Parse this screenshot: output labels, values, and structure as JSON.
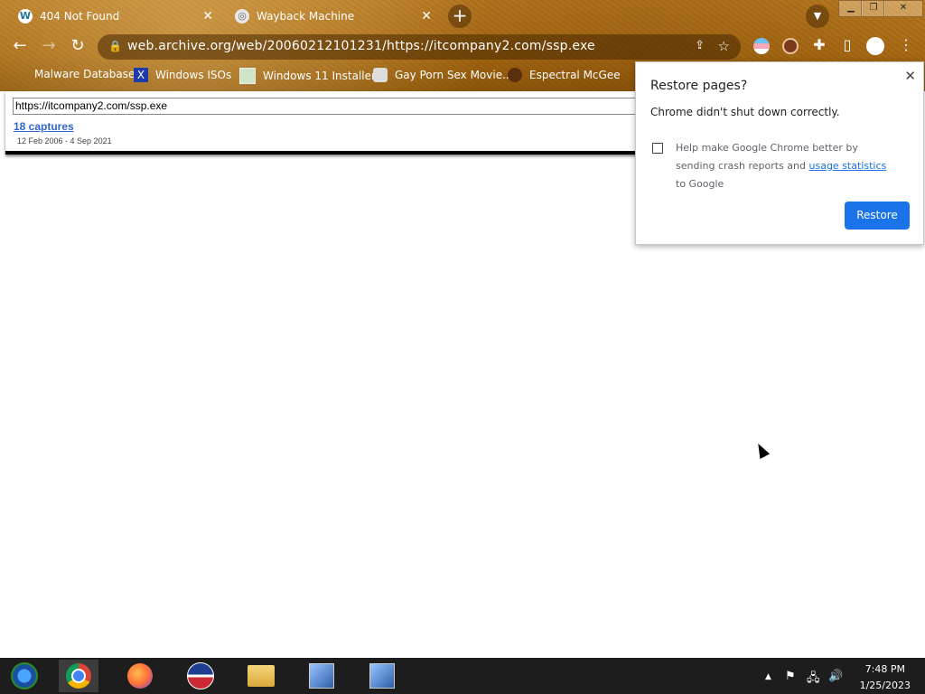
{
  "browser": {
    "tabs": [
      {
        "title": "404 Not Found",
        "favicon": "wordpress-icon"
      },
      {
        "title": "Wayback Machine",
        "favicon": "globe-icon"
      }
    ],
    "address": "web.archive.org/web/20060212101231/https://itcompany2.com/ssp.exe",
    "bookmarks": [
      {
        "label": "Malware Database"
      },
      {
        "label": "Windows ISOs"
      },
      {
        "label": "Windows 11 Installer"
      },
      {
        "label": "Gay Porn Sex Movie..."
      },
      {
        "label": "Espectral McGee"
      }
    ]
  },
  "page": {
    "url_field": "https://itcompany2.com/ssp.exe",
    "captures": "18 captures",
    "date_range": "12 Feb 2006 - 4 Sep 2021"
  },
  "dialog": {
    "title": "Restore pages?",
    "message": "Chrome didn't shut down correctly.",
    "help_prefix": "Help make Google Chrome better by sending crash reports and ",
    "help_link": "usage statistics",
    "help_suffix": " to Google",
    "button": "Restore"
  },
  "taskbar": {
    "time": "7:48 PM",
    "date": "1/25/2023"
  },
  "colors": {
    "accent": "#1a73e8",
    "link": "#3366cc",
    "theme": "#a86a14"
  }
}
